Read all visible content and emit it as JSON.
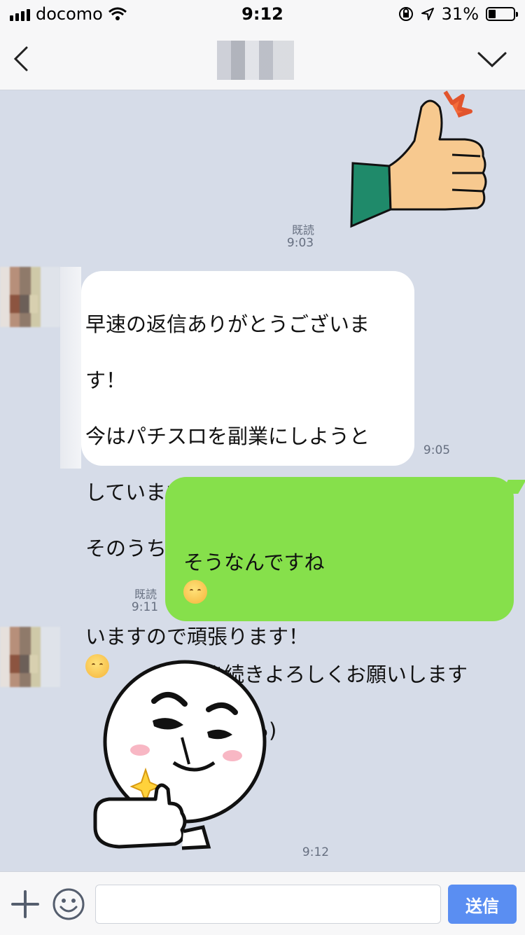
{
  "status_bar": {
    "carrier": "docomo",
    "time": "9:12",
    "battery": "31%",
    "battery_level": 0.31
  },
  "messages": [
    {
      "kind": "sticker",
      "side": "right",
      "sticker": "thumbs-up-hand",
      "read": "既読",
      "time": "9:03"
    },
    {
      "kind": "text",
      "side": "left",
      "lines": [
        "早速の返信ありがとうございま",
        "す！",
        "今はパチスロを副業にしようと",
        "していますが",
        "そのうち専業にしたいと思って",
        "いますので頑張ります！"
      ],
      "emoji": "smiling-face",
      "time": "9:05"
    },
    {
      "kind": "text",
      "side": "right",
      "line1": "そうなんですね",
      "emoji": "relieved-face",
      "line2": "引き続きよろしくお願いします",
      "line3": "(๑>◡<๑)",
      "read": "既読",
      "time": "9:11"
    },
    {
      "kind": "sticker",
      "side": "left",
      "sticker": "moon-character-thumbs-up",
      "time": "9:12"
    }
  ],
  "input_bar": {
    "placeholder": "",
    "send_label": "送信"
  },
  "colors": {
    "chat_background": "#d6dce8",
    "sent_bubble": "#86e04b",
    "received_bubble": "#ffffff",
    "send_button": "#5a8ef2"
  }
}
